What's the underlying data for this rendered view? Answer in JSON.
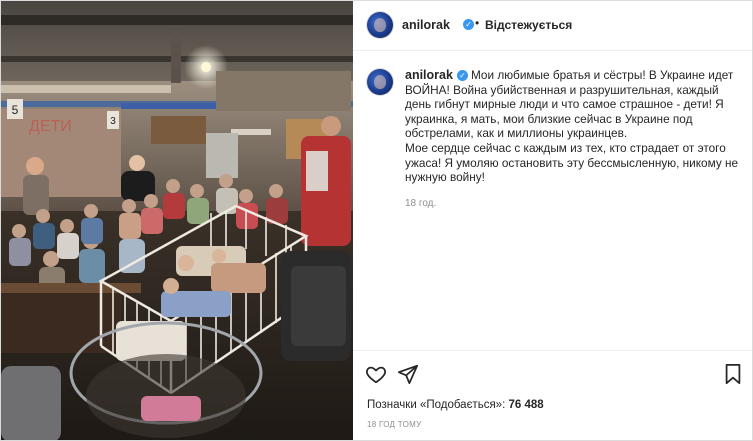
{
  "post": {
    "username": "anilorak",
    "verified_glyph": "✓",
    "separator": "•",
    "follow_label": "Відстежується",
    "caption_paragraphs": [
      "Мои любимые братья и сёстры! В Украине идет ВОЙНА! Война убийственная и разрушительная, каждый день гибнут мирные люди и что самое страшное - дети! Я украинка, я мать, мои близкие сейчас в Украине под обстрелами, как и миллионы украинцев.",
      "Мое сердце сейчас с каждым из тех, кто страдает от этого ужаса! Я умоляю остановить эту бессмысленную, никому не нужную войну!"
    ],
    "caption_time": "18 год.",
    "likes_label": "Позначки «Подобається»:",
    "likes_count": "76 488",
    "post_time": "18 ГОД ТОМУ"
  },
  "photo": {
    "wall_numbers": [
      "5",
      "3"
    ],
    "wall_graffiti": "ДЕТИ"
  },
  "icons": {
    "avatar": "avatar-icon",
    "like": "heart-icon",
    "share": "share-icon",
    "save": "bookmark-icon"
  },
  "colors": {
    "verified": "#3897f0",
    "text": "#262626",
    "secondary": "#8e8e8e",
    "border": "#dbdbdb"
  }
}
